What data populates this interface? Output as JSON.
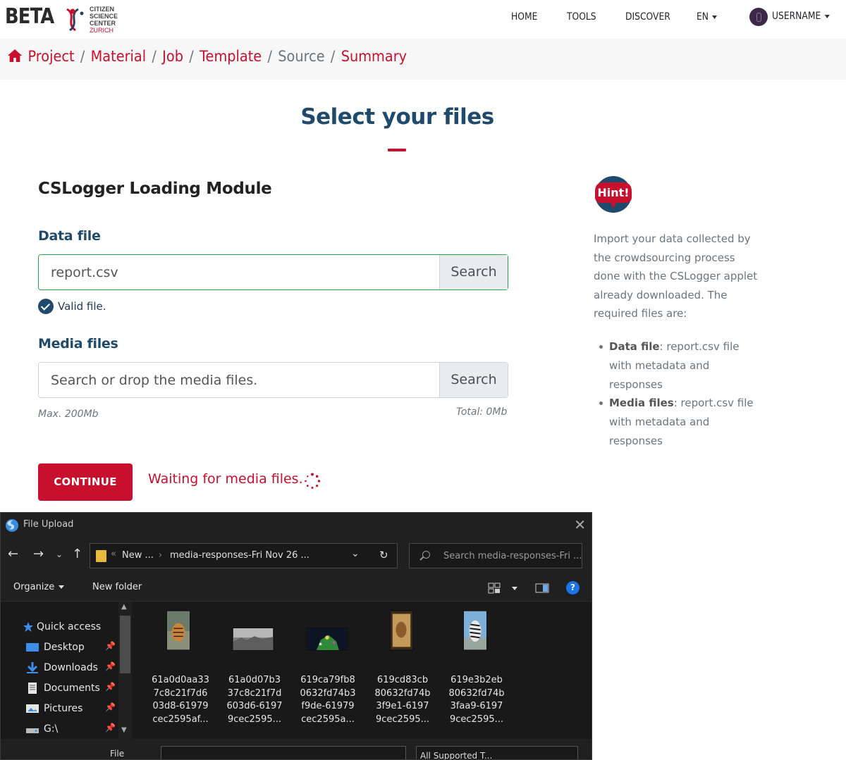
{
  "header": {
    "beta": "BETA",
    "logo_lines": [
      "CITIZEN",
      "SCIENCE",
      "CENTER",
      "ZURICH"
    ],
    "nav": [
      "HOME",
      "TOOLS",
      "DISCOVER"
    ],
    "lang": "EN",
    "username": "USERNAME"
  },
  "breadcrumb": {
    "items": [
      "Project",
      "Material",
      "Job",
      "Template",
      "Source",
      "Summary"
    ],
    "current": "Source"
  },
  "main": {
    "title": "Select your files",
    "module_title": "CSLogger Loading Module",
    "data_file": {
      "label": "Data file",
      "value": "report.csv",
      "search_label": "Search",
      "valid_text": "Valid file."
    },
    "media_files": {
      "label": "Media files",
      "placeholder": "Search or drop the media files.",
      "search_label": "Search",
      "max_text": "Max. 200Mb",
      "total_text": "Total: 0Mb"
    },
    "continue_label": "CONTINUE",
    "waiting_text": "Waiting for media files."
  },
  "hint": {
    "badge": "Hint!",
    "text": "Import your data collected by the crowdsourcing process done with the CSLogger applet already downloaded. The required files are:",
    "items": [
      {
        "bold": "Data file",
        "rest": ": report.csv file with metadata and responses"
      },
      {
        "bold": "Media files",
        "rest": ": report.csv file with metadata and responses"
      }
    ]
  },
  "dialog": {
    "title": "File Upload",
    "path": [
      "New ...",
      "media-responses-Fri Nov 26 ..."
    ],
    "search_placeholder": "Search media-responses-Fri ...",
    "organize": "Organize",
    "new_folder": "New folder",
    "sidebar": [
      {
        "label": "Quick access",
        "icon": "star-icon",
        "pinned": false
      },
      {
        "label": "Desktop",
        "icon": "desktop-icon",
        "pinned": true
      },
      {
        "label": "Downloads",
        "icon": "download-icon",
        "pinned": true
      },
      {
        "label": "Documents",
        "icon": "documents-icon",
        "pinned": true
      },
      {
        "label": "Pictures",
        "icon": "pictures-icon",
        "pinned": true
      },
      {
        "label": "G:\\",
        "icon": "drive-icon",
        "pinned": true
      }
    ],
    "files": [
      {
        "lines": [
          "61a0d0aa33",
          "7c8c21f7d6",
          "03d8-61979",
          "cec2595af..."
        ]
      },
      {
        "lines": [
          "61a0d07b3",
          "37c8c21f7d",
          "603d6-6197",
          "9cec2595..."
        ]
      },
      {
        "lines": [
          "619ca79fb8",
          "0632fd74b3",
          "f9de-61979",
          "cec2595a..."
        ]
      },
      {
        "lines": [
          "619cd83cb",
          "80632fd74b",
          "3f9e1-6197",
          "9cec2595..."
        ]
      },
      {
        "lines": [
          "619e3b2eb",
          "80632fd74b",
          "3faa9-6197",
          "9cec2595..."
        ]
      }
    ],
    "filename_label": "File",
    "filetype_value": "All Supported T..."
  },
  "colors": {
    "brand_red": "#c8102e",
    "heading_blue": "#1f4a6b",
    "valid_green": "#28a745"
  }
}
